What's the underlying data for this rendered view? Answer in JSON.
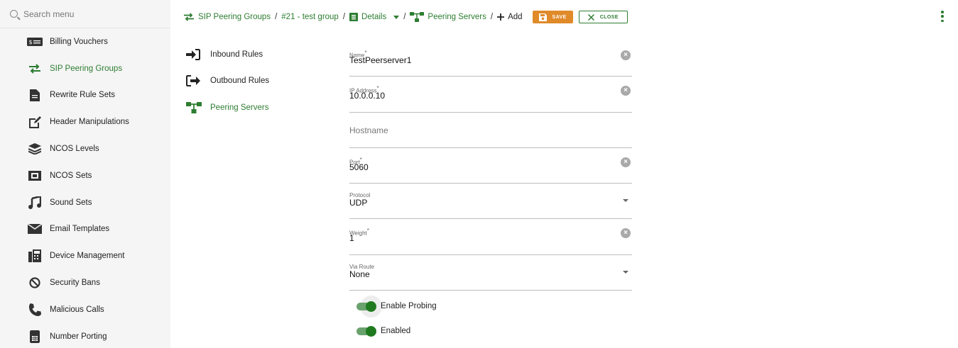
{
  "search": {
    "placeholder": "Search menu"
  },
  "sidebar": {
    "items": [
      {
        "label": "Billing Vouchers",
        "icon": "voucher-icon"
      },
      {
        "label": "SIP Peering Groups",
        "icon": "swap-arrows-icon",
        "active": true
      },
      {
        "label": "Rewrite Rule Sets",
        "icon": "file-icon"
      },
      {
        "label": "Header Manipulations",
        "icon": "edit-icon"
      },
      {
        "label": "NCOS Levels",
        "icon": "layers-icon"
      },
      {
        "label": "NCOS Sets",
        "icon": "sets-icon"
      },
      {
        "label": "Sound Sets",
        "icon": "music-note-icon"
      },
      {
        "label": "Email Templates",
        "icon": "envelope-icon"
      },
      {
        "label": "Device Management",
        "icon": "fax-icon"
      },
      {
        "label": "Security Bans",
        "icon": "ban-icon"
      },
      {
        "label": "Malicious Calls",
        "icon": "phone-icon"
      },
      {
        "label": "Number Porting",
        "icon": "sim-card-icon"
      }
    ]
  },
  "breadcrumb": {
    "group": "SIP Peering Groups",
    "item": "#21 - test group",
    "details": "Details",
    "servers": "Peering Servers",
    "add": "Add"
  },
  "toolbar": {
    "save_label": "SAVE",
    "close_label": "CLOSE"
  },
  "subnav": {
    "items": [
      {
        "label": "Inbound Rules"
      },
      {
        "label": "Outbound Rules"
      },
      {
        "label": "Peering Servers",
        "active": true
      }
    ]
  },
  "form": {
    "name": {
      "label": "Name",
      "value": "TestPeerserver1"
    },
    "ip": {
      "label": "IP Address",
      "value": "10.0.0.10"
    },
    "hostname": {
      "placeholder": "Hostname"
    },
    "port": {
      "label": "Port",
      "value": "5060"
    },
    "protocol": {
      "label": "Protocol",
      "value": "UDP"
    },
    "weight": {
      "label": "Weight",
      "value": "1"
    },
    "via_route": {
      "label": "Via Route",
      "value": "None"
    },
    "required_mark": "*",
    "enable_probing": {
      "label": "Enable Probing",
      "checked": true
    },
    "enabled": {
      "label": "Enabled",
      "checked": true
    }
  },
  "colors": {
    "accent": "#2e7d32",
    "save": "#e08a2a"
  }
}
